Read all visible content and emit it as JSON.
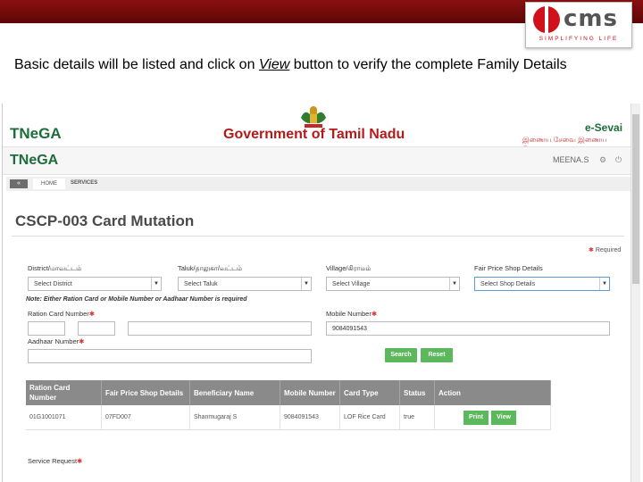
{
  "slide": {
    "caption_pre": "Basic details will be listed and click on ",
    "caption_link": "View",
    "caption_post": " button to verify the complete Family Details",
    "logo": {
      "wordmark": "cms",
      "tagline": "SIMPLIFYING LIFE"
    }
  },
  "portal": {
    "brand": "TNeGA",
    "government": "Government of Tamil Nadu",
    "esevai": "e-Sevai",
    "esevai_tamil": "இணைய சேவை இணைய சேவை",
    "user": "MEENA.S",
    "breadcrumb": {
      "back": "«",
      "home": "HOME",
      "services": "SERVICES"
    },
    "page_title": "CSCP-003 Card Mutation",
    "required_label": "Required"
  },
  "form": {
    "district": {
      "label": "District/மாவட்டம்",
      "value": "Select District"
    },
    "taluk": {
      "label": "Taluk/தாலுகா/வட்டம்",
      "value": "Select Taluk"
    },
    "village": {
      "label": "Village/கிராமம்",
      "value": "Select Village"
    },
    "fps": {
      "label": "Fair Price Shop Details",
      "value": "Select Shop Details"
    },
    "note": "Note: Either Ration Card or Mobile Number or Aadhaar Number is required",
    "ration_label": "Ration Card Number",
    "mobile_label": "Mobile Number",
    "mobile_value": "9084091543",
    "aadhaar_label": "Aadhaar Number",
    "search_label": "Search",
    "reset_label": "Reset",
    "service_request_label": "Service Request"
  },
  "table": {
    "headers": [
      "Ration Card Number",
      "Fair Price Shop Details",
      "Beneficiary Name",
      "Mobile Number",
      "Card Type",
      "Status",
      "Action"
    ],
    "rows": [
      {
        "ration": "01G1001071",
        "shop": "07FD007",
        "name": "Shanmugaraj S",
        "mobile": "9084091543",
        "card_type": "LOF Rice Card",
        "status": "true",
        "print_label": "Print",
        "view_label": "View"
      }
    ]
  },
  "colors": {
    "brand_green": "#1c6d3a",
    "gov_red": "#b41a1a",
    "button_green": "#5cb85c",
    "table_header": "#8a8a8a"
  },
  "icons": [
    "gear-icon",
    "power-icon",
    "chevron-down-icon",
    "emblem-icon"
  ]
}
